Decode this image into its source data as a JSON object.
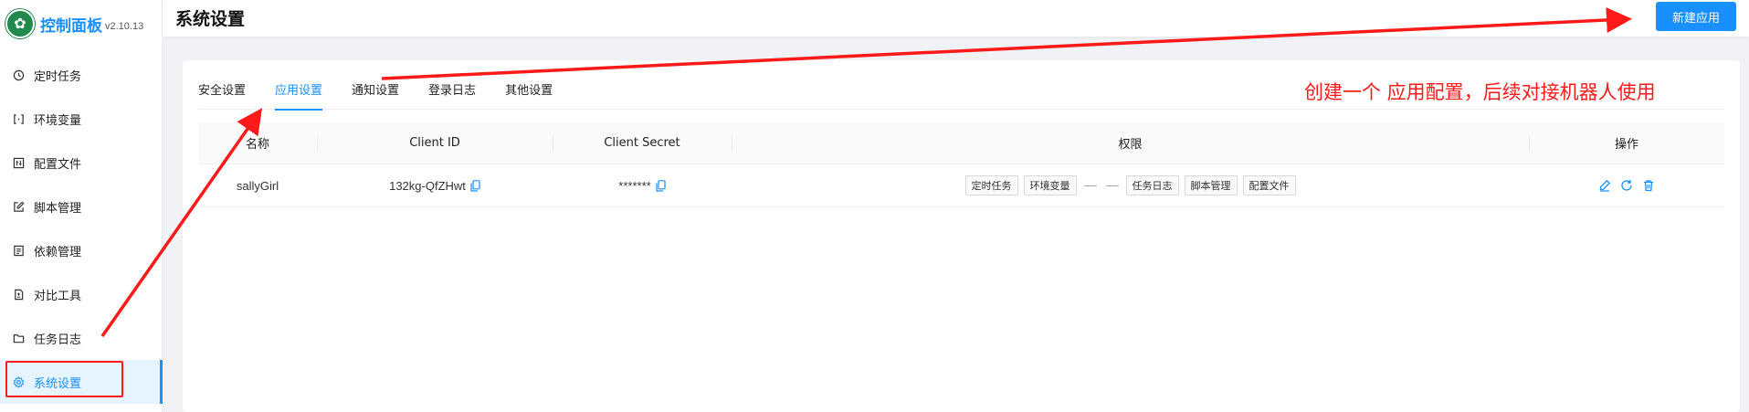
{
  "app": {
    "title": "控制面板",
    "version": "v2.10.13"
  },
  "sidebar": {
    "items": [
      {
        "label": "定时任务",
        "icon": "clock-icon"
      },
      {
        "label": "环境变量",
        "icon": "variable-icon"
      },
      {
        "label": "配置文件",
        "icon": "config-icon"
      },
      {
        "label": "脚本管理",
        "icon": "edit-icon"
      },
      {
        "label": "依赖管理",
        "icon": "dependency-icon"
      },
      {
        "label": "对比工具",
        "icon": "diff-icon"
      },
      {
        "label": "任务日志",
        "icon": "folder-icon"
      },
      {
        "label": "系统设置",
        "icon": "settings-icon",
        "active": true
      }
    ]
  },
  "header": {
    "title": "系统设置",
    "new_app_label": "新建应用"
  },
  "tabs": [
    "安全设置",
    "应用设置",
    "通知设置",
    "登录日志",
    "其他设置"
  ],
  "active_tab": "应用设置",
  "annotation": "创建一个 应用配置，后续对接机器人使用",
  "table": {
    "columns": [
      "名称",
      "Client ID",
      "Client Secret",
      "权限",
      "操作"
    ],
    "rows": [
      {
        "name": "sallyGirl",
        "client_id": "132kg-QfZHwt",
        "client_secret": "*******",
        "permissions": [
          "定时任务",
          "环境变量",
          "任务日志",
          "脚本管理",
          "配置文件"
        ]
      }
    ]
  },
  "colors": {
    "accent": "#1890ff",
    "annotation_red": "#ff1a1a"
  }
}
